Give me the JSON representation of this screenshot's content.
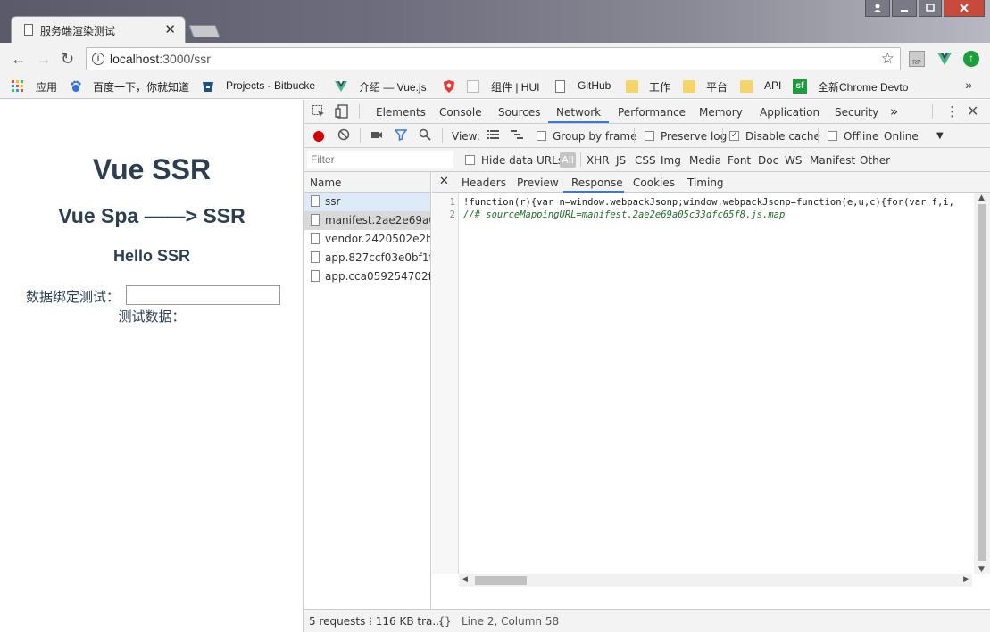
{
  "browser": {
    "tab_title": "服务端渲染测试",
    "tab_close": "✕",
    "url_host": "localhost",
    "url_path": ":3000/ssr",
    "nav": {
      "back": "←",
      "forward": "→",
      "reload": "↻"
    }
  },
  "bookmarks": {
    "items": [
      {
        "label": "应用",
        "icon": "apps-grid-icon"
      },
      {
        "label": "百度一下，你就知道",
        "icon": "baidu-paw-icon"
      },
      {
        "label": "Projects - Bitbucke",
        "icon": "bitbucket-icon"
      },
      {
        "label": "介绍 — Vue.js",
        "icon": "vue-logo-icon"
      },
      {
        "label": "组件 | HUI",
        "icon": "hui-icon"
      },
      {
        "label": "GitHub",
        "icon": "page-icon"
      },
      {
        "label": "工作",
        "icon": "folder-icon"
      },
      {
        "label": "平台",
        "icon": "folder-icon"
      },
      {
        "label": "API",
        "icon": "folder-icon"
      },
      {
        "label": "全新Chrome Devto",
        "icon": "sf-icon"
      }
    ],
    "more": "»"
  },
  "page": {
    "h1": "Vue SSR",
    "h2": "Vue Spa ——> SSR",
    "h3": "Hello SSR",
    "bind_label": "数据绑定测试：",
    "bind_value": "",
    "test_data": "测试数据："
  },
  "devtools": {
    "tabs": [
      "Elements",
      "Console",
      "Sources",
      "Network",
      "Performance",
      "Memory",
      "Application",
      "Security"
    ],
    "active_tab": "Network",
    "more_tabs": "»",
    "toolbar": {
      "view_label": "View:",
      "group_by_frame": "Group by frame",
      "preserve_log": "Preserve log",
      "disable_cache": "Disable cache",
      "offline": "Offline",
      "throttle": "Online"
    },
    "filter": {
      "placeholder": "Filter",
      "hide_data_urls": "Hide data URLs",
      "types": [
        "All",
        "XHR",
        "JS",
        "CSS",
        "Img",
        "Media",
        "Font",
        "Doc",
        "WS",
        "Manifest",
        "Other"
      ]
    },
    "requests": {
      "header": "Name",
      "rows": [
        "ssr",
        "manifest.2ae2e69a0...",
        "vendor.2420502e2b...",
        "app.827ccf03e0bf1f...",
        "app.cca059254702f..."
      ]
    },
    "response_tabs": [
      "Headers",
      "Preview",
      "Response",
      "Cookies",
      "Timing"
    ],
    "active_response_tab": "Response",
    "code": {
      "line1": "!function(r){var n=window.webpackJsonp;window.webpackJsonp=function(e,u,c){for(var f,i,",
      "line2": "//# sourceMappingURL=manifest.2ae2e69a05c33dfc65f8.js.map"
    },
    "status": {
      "summary": "5 requests  ⁞  116 KB tra...",
      "position": "Line 2, Column 58",
      "pretty_print": "{}"
    }
  },
  "colors": {
    "vue_text": "#2c3e50",
    "accent_blue": "#3879d9",
    "record_red": "#d50000"
  }
}
